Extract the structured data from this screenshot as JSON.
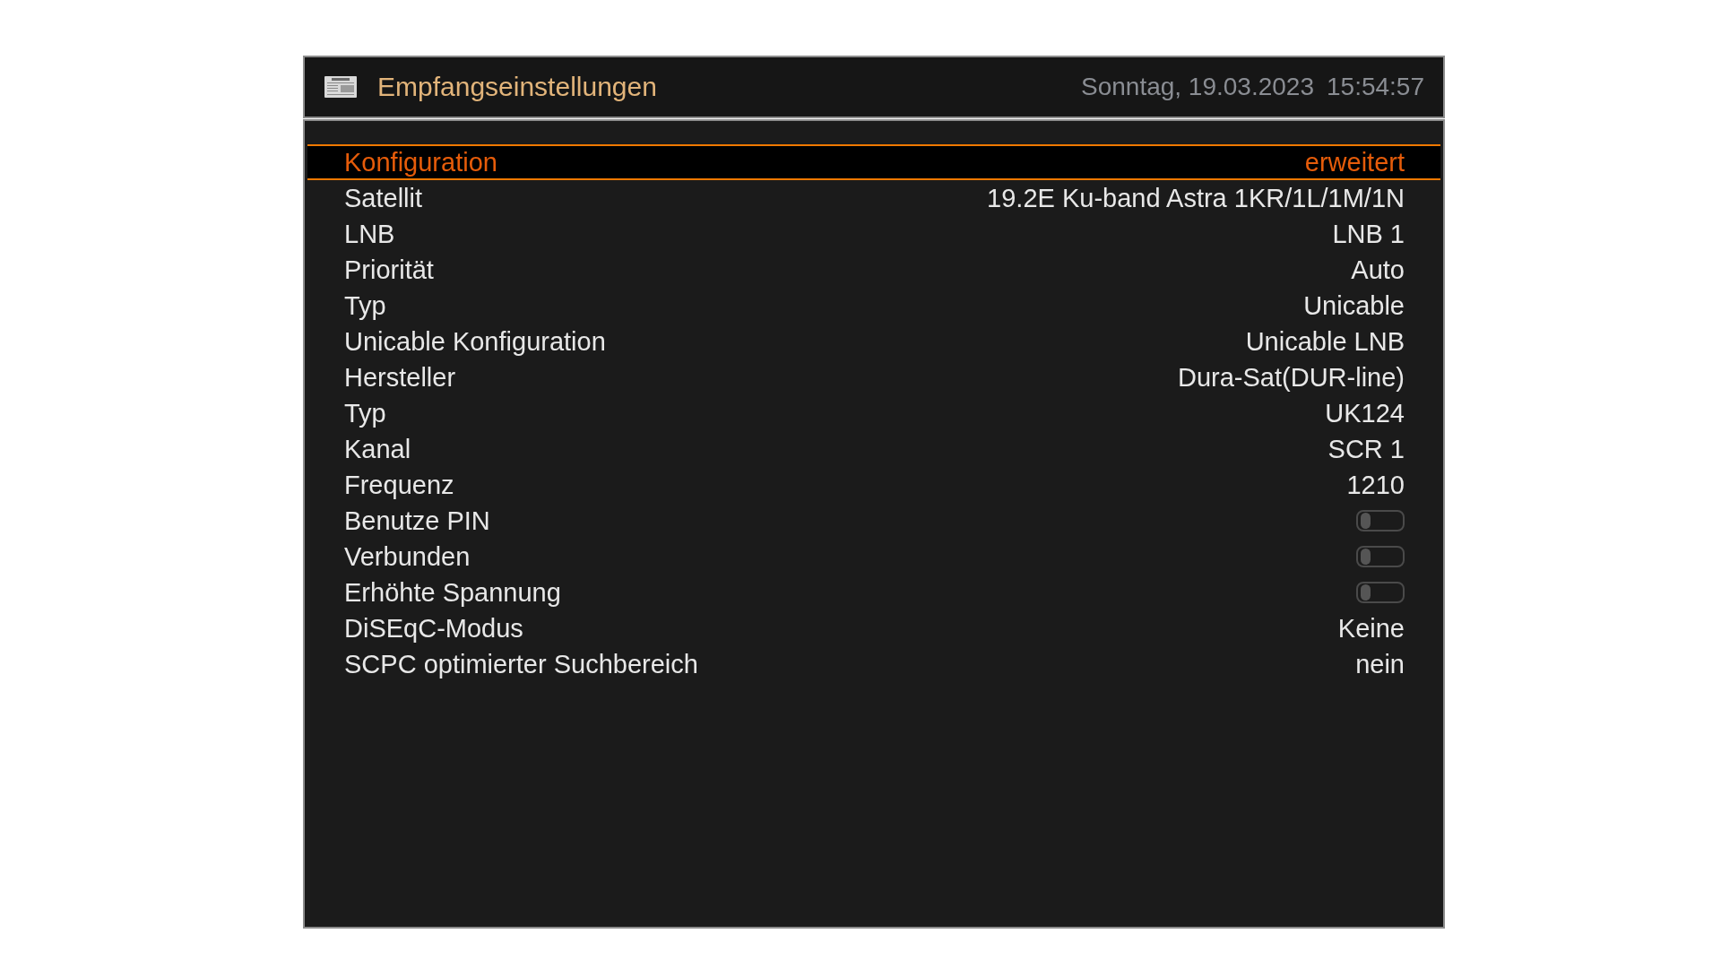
{
  "header": {
    "title": "Empfangseinstellungen",
    "date": "Sonntag, 19.03.2023",
    "time": "15:54:57"
  },
  "settings": [
    {
      "kind": "value",
      "label": "Konfiguration",
      "value": "erweitert",
      "selected": true
    },
    {
      "kind": "value",
      "label": "Satellit",
      "value": "19.2E Ku-band Astra 1KR/1L/1M/1N",
      "selected": false
    },
    {
      "kind": "value",
      "label": "LNB",
      "value": "LNB 1",
      "selected": false
    },
    {
      "kind": "value",
      "label": "Priorität",
      "value": "Auto",
      "selected": false
    },
    {
      "kind": "value",
      "label": "Typ",
      "value": "Unicable",
      "selected": false
    },
    {
      "kind": "value",
      "label": "Unicable Konfiguration",
      "value": "Unicable LNB",
      "selected": false
    },
    {
      "kind": "value",
      "label": "Hersteller",
      "value": "Dura-Sat(DUR-line)",
      "selected": false
    },
    {
      "kind": "value",
      "label": "Typ",
      "value": "UK124",
      "selected": false
    },
    {
      "kind": "value",
      "label": "Kanal",
      "value": "SCR 1",
      "selected": false
    },
    {
      "kind": "value",
      "label": "Frequenz",
      "value": "1210",
      "selected": false
    },
    {
      "kind": "toggle",
      "label": "Benutze PIN",
      "on": false,
      "selected": false
    },
    {
      "kind": "toggle",
      "label": "Verbunden",
      "on": false,
      "selected": false
    },
    {
      "kind": "toggle",
      "label": "Erhöhte Spannung",
      "on": false,
      "selected": false
    },
    {
      "kind": "value",
      "label": "DiSEqC-Modus",
      "value": "Keine",
      "selected": false
    },
    {
      "kind": "value",
      "label": "SCPC optimierter Suchbereich",
      "value": "nein",
      "selected": false
    }
  ]
}
